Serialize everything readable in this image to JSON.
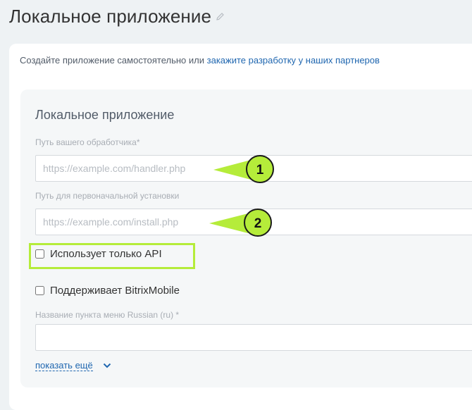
{
  "header": {
    "title": "Локальное приложение",
    "edit_icon": "pencil-icon"
  },
  "hint": {
    "text": "Создайте приложение самостоятельно или ",
    "link_text": "закажите разработку у наших партнеров"
  },
  "form": {
    "title": "Локальное приложение",
    "handler_label": "Путь вашего обработчика*",
    "handler_placeholder": "https://example.com/handler.php",
    "install_label": "Путь для первоначальной установки",
    "install_placeholder": "https://example.com/install.php",
    "api_only_label": "Использует только API",
    "bitrix_mobile_label": "Поддерживает BitrixMobile",
    "menu_label": "Название пункта меню Russian (ru) *",
    "menu_value": "",
    "show_more": "показать ещё"
  },
  "annotations": {
    "marker_1": "1",
    "marker_2": "2",
    "color": "#b5ec3a"
  }
}
